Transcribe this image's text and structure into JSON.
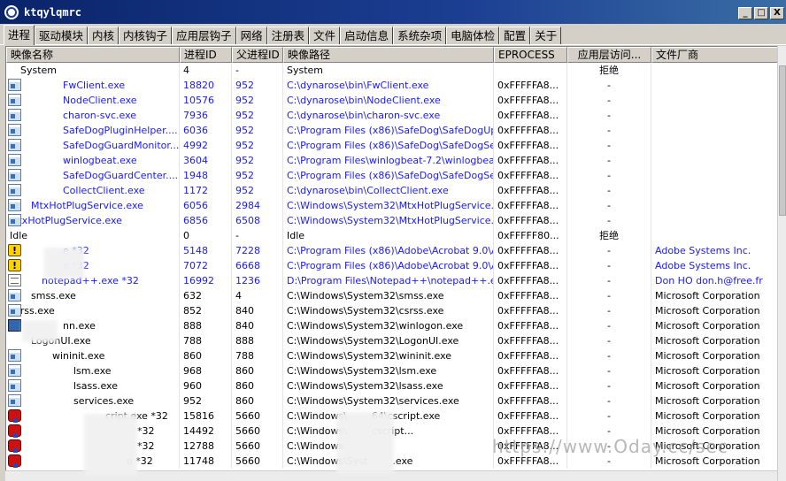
{
  "window": {
    "title": "ktqylqmrc",
    "buttons": [
      "_",
      "□",
      "X"
    ]
  },
  "tabs": [
    {
      "label": "进程",
      "active": true
    },
    {
      "label": "驱动模块"
    },
    {
      "label": "内核"
    },
    {
      "label": "内核钩子"
    },
    {
      "label": "应用层钩子"
    },
    {
      "label": "网络"
    },
    {
      "label": "注册表"
    },
    {
      "label": "文件"
    },
    {
      "label": "启动信息"
    },
    {
      "label": "系统杂项"
    },
    {
      "label": "电脑体检"
    },
    {
      "label": "配置"
    },
    {
      "label": "关于"
    }
  ],
  "columns": [
    "映像名称",
    "进程ID",
    "父进程ID",
    "映像路径",
    "EPROCESS",
    "应用层访问...",
    "文件厂商"
  ],
  "rows": [
    {
      "name": "System",
      "indent": 1,
      "icon": "none",
      "pid": "4",
      "ppid": "-",
      "path": "System",
      "eprocess": "",
      "access": "拒绝",
      "vendor": "",
      "color": "black"
    },
    {
      "name": "FwClient.exe",
      "indent": 5,
      "icon": "window-icon",
      "pid": "18820",
      "ppid": "952",
      "path": "C:\\dynarose\\bin\\FwClient.exe",
      "eprocess": "0xFFFFFA8...",
      "access": "-",
      "vendor": "",
      "color": "blue"
    },
    {
      "name": "NodeClient.exe",
      "indent": 5,
      "icon": "window-icon",
      "pid": "10576",
      "ppid": "952",
      "path": "C:\\dynarose\\bin\\NodeClient.exe",
      "eprocess": "0xFFFFFA8...",
      "access": "-",
      "vendor": "",
      "color": "blue"
    },
    {
      "name": "charon-svc.exe",
      "indent": 5,
      "icon": "window-icon",
      "pid": "7936",
      "ppid": "952",
      "path": "C:\\dynarose\\bin\\charon-svc.exe",
      "eprocess": "0xFFFFFA8...",
      "access": "-",
      "vendor": "",
      "color": "blue"
    },
    {
      "name": "SafeDogPluginHelper....",
      "indent": 5,
      "icon": "window-icon",
      "pid": "6036",
      "ppid": "952",
      "path": "C:\\Program Files (x86)\\SafeDog\\SafeDogUp...",
      "eprocess": "0xFFFFFA8...",
      "access": "-",
      "vendor": "",
      "color": "blue"
    },
    {
      "name": "SafeDogGuardMonitor....",
      "indent": 5,
      "icon": "window-icon",
      "pid": "4992",
      "ppid": "952",
      "path": "C:\\Program Files (x86)\\SafeDog\\SafeDogSer...",
      "eprocess": "0xFFFFFA8...",
      "access": "-",
      "vendor": "",
      "color": "blue"
    },
    {
      "name": "winlogbeat.exe",
      "indent": 5,
      "icon": "window-icon",
      "pid": "3604",
      "ppid": "952",
      "path": "C:\\Program Files\\winlogbeat-7.2\\winlogbeat....",
      "eprocess": "0xFFFFFA8...",
      "access": "-",
      "vendor": "",
      "color": "blue"
    },
    {
      "name": "SafeDogGuardCenter....",
      "indent": 5,
      "icon": "window-icon",
      "pid": "1948",
      "ppid": "952",
      "path": "C:\\Program Files (x86)\\SafeDog\\SafeDogSer...",
      "eprocess": "0xFFFFFA8...",
      "access": "-",
      "vendor": "",
      "color": "blue"
    },
    {
      "name": "CollectClient.exe",
      "indent": 5,
      "icon": "window-icon",
      "pid": "1172",
      "ppid": "952",
      "path": "C:\\dynarose\\bin\\CollectClient.exe",
      "eprocess": "0xFFFFFA8...",
      "access": "-",
      "vendor": "",
      "color": "blue"
    },
    {
      "name": "MtxHotPlugService.exe",
      "indent": 2,
      "icon": "window-icon",
      "pid": "6056",
      "ppid": "2984",
      "path": "C:\\Windows\\System32\\MtxHotPlugService.exe",
      "eprocess": "0xFFFFFA8...",
      "access": "-",
      "vendor": "",
      "color": "blue"
    },
    {
      "name": "MtxHotPlugService.exe",
      "indent": 0,
      "icon": "window-icon",
      "pid": "6856",
      "ppid": "6508",
      "path": "C:\\Windows\\System32\\MtxHotPlugService.exe",
      "eprocess": "0xFFFFFA8...",
      "access": "-",
      "vendor": "",
      "color": "blue"
    },
    {
      "name": "Idle",
      "indent": 0,
      "icon": "none",
      "pid": "0",
      "ppid": "-",
      "path": "Idle",
      "eprocess": "0xFFFFF80...",
      "access": "拒绝",
      "vendor": "",
      "color": "black"
    },
    {
      "name": "e *32",
      "indent": 5,
      "icon": "warning-icon",
      "pid": "5148",
      "ppid": "7228",
      "path": "C:\\Program Files (x86)\\Adobe\\Acrobat 9.0\\A...",
      "eprocess": "0xFFFFFA8...",
      "access": "-",
      "vendor": "Adobe Systems Inc.",
      "color": "blue"
    },
    {
      "name": "e *32",
      "indent": 5,
      "icon": "warning-icon",
      "pid": "7072",
      "ppid": "6668",
      "path": "C:\\Program Files (x86)\\Adobe\\Acrobat 9.0\\A...",
      "eprocess": "0xFFFFFA8...",
      "access": "-",
      "vendor": "Adobe Systems Inc.",
      "color": "blue"
    },
    {
      "name": "notepad++.exe *32",
      "indent": 3,
      "icon": "notepad-icon",
      "pid": "16992",
      "ppid": "1236",
      "path": "D:\\Program Files\\Notepad++\\notepad++.exe",
      "eprocess": "0xFFFFFA8...",
      "access": "-",
      "vendor": "Don HO don.h@free.fr",
      "color": "blue"
    },
    {
      "name": "smss.exe",
      "indent": 2,
      "icon": "window-icon",
      "pid": "632",
      "ppid": "4",
      "path": "C:\\Windows\\System32\\smss.exe",
      "eprocess": "0xFFFFFA8...",
      "access": "-",
      "vendor": "Microsoft Corporation",
      "color": "black"
    },
    {
      "name": "csrss.exe",
      "indent": 0,
      "icon": "window-icon",
      "pid": "852",
      "ppid": "840",
      "path": "C:\\Windows\\System32\\csrss.exe",
      "eprocess": "0xFFFFFA8...",
      "access": "-",
      "vendor": "Microsoft Corporation",
      "color": "black"
    },
    {
      "name": "nn.exe",
      "indent": 5,
      "icon": "user-icon",
      "pid": "888",
      "ppid": "840",
      "path": "C:\\Windows\\System32\\winlogon.exe",
      "eprocess": "0xFFFFFA8...",
      "access": "-",
      "vendor": "Microsoft Corporation",
      "color": "black"
    },
    {
      "name": "LogonUI.exe",
      "indent": 2,
      "icon": "none",
      "pid": "788",
      "ppid": "888",
      "path": "C:\\Windows\\System32\\LogonUI.exe",
      "eprocess": "0xFFFFFA8...",
      "access": "-",
      "vendor": "Microsoft Corporation",
      "color": "black"
    },
    {
      "name": "wininit.exe",
      "indent": 4,
      "icon": "window-icon",
      "pid": "860",
      "ppid": "788",
      "path": "C:\\Windows\\System32\\wininit.exe",
      "eprocess": "0xFFFFFA8...",
      "access": "-",
      "vendor": "Microsoft Corporation",
      "color": "black"
    },
    {
      "name": "lsm.exe",
      "indent": 6,
      "icon": "window-icon",
      "pid": "968",
      "ppid": "860",
      "path": "C:\\Windows\\System32\\lsm.exe",
      "eprocess": "0xFFFFFA8...",
      "access": "-",
      "vendor": "Microsoft Corporation",
      "color": "black"
    },
    {
      "name": "lsass.exe",
      "indent": 6,
      "icon": "window-icon",
      "pid": "960",
      "ppid": "860",
      "path": "C:\\Windows\\System32\\lsass.exe",
      "eprocess": "0xFFFFFA8...",
      "access": "-",
      "vendor": "Microsoft Corporation",
      "color": "black"
    },
    {
      "name": "services.exe",
      "indent": 6,
      "icon": "window-icon",
      "pid": "952",
      "ppid": "860",
      "path": "C:\\Windows\\System32\\services.exe",
      "eprocess": "0xFFFFFA8...",
      "access": "-",
      "vendor": "Microsoft Corporation",
      "color": "black"
    },
    {
      "name": "cript.exe *32",
      "indent": 9,
      "icon": "red-icon",
      "pid": "15816",
      "ppid": "5660",
      "path": "C:\\Windows\\",
      "path_tail": "64\\cscript.exe",
      "eprocess": "0xFFFFFA8...",
      "access": "-",
      "vendor": "Microsoft Corporation",
      "color": "black"
    },
    {
      "name": "*32",
      "indent": 12,
      "icon": "red-icon",
      "pid": "14492",
      "ppid": "5660",
      "path": "C:\\Windows\\",
      "path_tail": "cscript...",
      "eprocess": "0xFFFFFA8...",
      "access": "-",
      "vendor": "Microsoft Corporation",
      "color": "black"
    },
    {
      "name": "*32",
      "indent": 12,
      "icon": "red-icon",
      "pid": "12788",
      "ppid": "5660",
      "path": "C:\\Windows",
      "path_tail": "",
      "eprocess": "0xFFFFFA8...",
      "access": "-",
      "vendor": "Microsoft Corporation",
      "color": "black"
    },
    {
      "name": "e *32",
      "indent": 11,
      "icon": "red-icon",
      "pid": "11748",
      "ppid": "5660",
      "path": "C:\\Windows\\Syst",
      "path_tail": ".exe",
      "eprocess": "0xFFFFFA8...",
      "access": "-",
      "vendor": "Microsoft Corporation",
      "color": "black"
    }
  ],
  "watermark": "https://www.Oday.cc/sec"
}
